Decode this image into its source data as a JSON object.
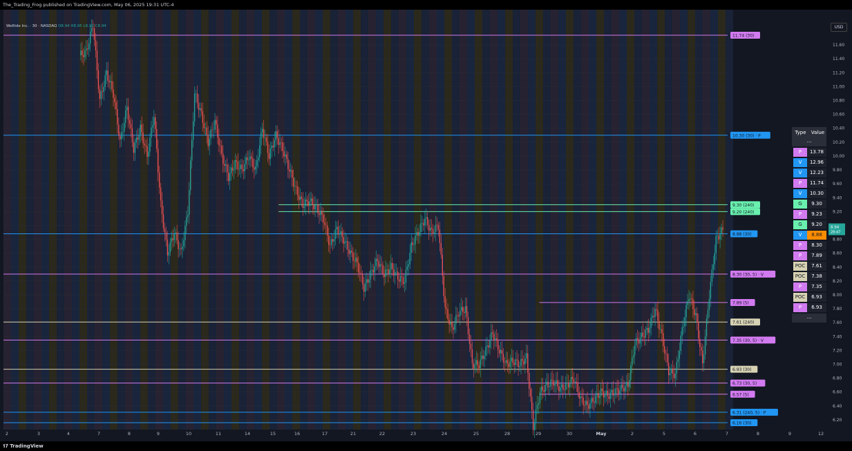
{
  "header": {
    "published": "The_Trading_Frog published on TradingView.com, May 06, 2025 19:31 UTC-4"
  },
  "legend": {
    "symbol": "WeRide Inc. · 30 · NASDAQ",
    "o": "O8.94",
    "h": "H8.95",
    "l": "L8.92",
    "c": "C8.94"
  },
  "currency": "USD",
  "footer": {
    "brand": "TradingView"
  },
  "colors": {
    "bg": "#131722",
    "pivot": "#d27af0",
    "volume": "#2196f3",
    "gap": "#69f0ae",
    "poc": "#d6d2b3",
    "up": "#26a69a",
    "down": "#ef5350",
    "last": "#fb8c00"
  },
  "chart_data": {
    "type": "candlestick",
    "ylim": [
      6.1,
      11.8
    ],
    "y_ticks": [
      "11.60",
      "11.40",
      "11.20",
      "11.00",
      "10.80",
      "10.60",
      "10.40",
      "10.20",
      "10.00",
      "9.80",
      "9.60",
      "9.40",
      "9.20",
      "9.00",
      "8.80",
      "8.60",
      "8.40",
      "8.20",
      "8.00",
      "7.80",
      "7.60",
      "7.40",
      "7.20",
      "7.00",
      "6.80",
      "6.60",
      "6.40",
      "6.20"
    ],
    "x_ticks": [
      "2",
      "3",
      "4",
      "7",
      "8",
      "9",
      "10",
      "11",
      "14",
      "15",
      "16",
      "17",
      "21",
      "22",
      "23",
      "24",
      "25",
      "28",
      "29",
      "30",
      "May",
      "2",
      "5",
      "6",
      "7",
      "8",
      "9",
      "12"
    ],
    "last_price": "8.94",
    "last_price_sub": "8.94",
    "last_price_time": "28:47",
    "price_path": [
      [
        0,
        11.45
      ],
      [
        2,
        11.5
      ],
      [
        3,
        11.9
      ],
      [
        4,
        10.8
      ],
      [
        5,
        11.2
      ],
      [
        6,
        10.9
      ],
      [
        7,
        10.2
      ],
      [
        8,
        10.7
      ],
      [
        9,
        10.1
      ],
      [
        10,
        10.4
      ],
      [
        11,
        10.0
      ],
      [
        12,
        10.6
      ],
      [
        13,
        9.3
      ],
      [
        14,
        8.6
      ],
      [
        15,
        8.9
      ],
      [
        16,
        8.6
      ],
      [
        17,
        9.2
      ],
      [
        18,
        10.9
      ],
      [
        19,
        10.6
      ],
      [
        20,
        10.2
      ],
      [
        21,
        10.5
      ],
      [
        22,
        10.0
      ],
      [
        23,
        9.7
      ],
      [
        24,
        9.9
      ],
      [
        25,
        9.8
      ],
      [
        26,
        10.0
      ],
      [
        27,
        9.8
      ],
      [
        28,
        10.4
      ],
      [
        29,
        10.0
      ],
      [
        30,
        10.3
      ],
      [
        31,
        10.1
      ],
      [
        32,
        9.8
      ],
      [
        33,
        9.5
      ],
      [
        34,
        9.3
      ],
      [
        35,
        9.35
      ],
      [
        36,
        9.25
      ],
      [
        37,
        9.1
      ],
      [
        38,
        8.7
      ],
      [
        39,
        8.95
      ],
      [
        40,
        8.8
      ],
      [
        41,
        8.6
      ],
      [
        42,
        8.45
      ],
      [
        43,
        8.1
      ],
      [
        44,
        8.3
      ],
      [
        45,
        8.5
      ],
      [
        46,
        8.3
      ],
      [
        47,
        8.4
      ],
      [
        48,
        8.25
      ],
      [
        49,
        8.2
      ],
      [
        50,
        8.7
      ],
      [
        51,
        8.9
      ],
      [
        52,
        9.1
      ],
      [
        53,
        8.9
      ],
      [
        54,
        9.0
      ],
      [
        55,
        7.8
      ],
      [
        56,
        7.5
      ],
      [
        57,
        7.75
      ],
      [
        58,
        7.8
      ],
      [
        59,
        7.0
      ],
      [
        60,
        7.0
      ],
      [
        61,
        7.2
      ],
      [
        62,
        7.45
      ],
      [
        63,
        7.2
      ],
      [
        64,
        7.0
      ],
      [
        65,
        7.05
      ],
      [
        66,
        7.0
      ],
      [
        67,
        7.1
      ],
      [
        68,
        6.1
      ],
      [
        69,
        6.6
      ],
      [
        70,
        6.7
      ],
      [
        71,
        6.75
      ],
      [
        72,
        6.65
      ],
      [
        73,
        6.7
      ],
      [
        74,
        6.8
      ],
      [
        75,
        6.5
      ],
      [
        76,
        6.4
      ],
      [
        77,
        6.5
      ],
      [
        78,
        6.6
      ],
      [
        79,
        6.55
      ],
      [
        80,
        6.6
      ],
      [
        81,
        6.65
      ],
      [
        82,
        6.7
      ],
      [
        83,
        7.3
      ],
      [
        84,
        7.4
      ],
      [
        85,
        7.5
      ],
      [
        86,
        7.8
      ],
      [
        87,
        7.4
      ],
      [
        88,
        6.9
      ],
      [
        89,
        6.85
      ],
      [
        90,
        7.5
      ],
      [
        91,
        8.0
      ],
      [
        92,
        7.7
      ],
      [
        93,
        7.0
      ],
      [
        94,
        8.0
      ],
      [
        95,
        8.8
      ],
      [
        96,
        8.94
      ]
    ],
    "levels": [
      {
        "label": "11.74 (30)",
        "price": 11.74,
        "kind": "pivot",
        "start": 0
      },
      {
        "label": "10.30 (30) · P",
        "price": 10.3,
        "kind": "volume",
        "start": 0
      },
      {
        "label": "9.30 (240)",
        "price": 9.3,
        "kind": "gap",
        "start": 0.38
      },
      {
        "label": "9.20 (240)",
        "price": 9.2,
        "kind": "gap",
        "start": 0.38
      },
      {
        "label": "8.88 (30)",
        "price": 8.88,
        "kind": "volume",
        "start": 0
      },
      {
        "label": "8.30 (30, 5) · V",
        "price": 8.3,
        "kind": "pivot",
        "start": 0
      },
      {
        "label": "7.89 (5)",
        "price": 7.89,
        "kind": "pivot",
        "start": 0.74
      },
      {
        "label": "7.61 (240)",
        "price": 7.61,
        "kind": "poc",
        "start": 0
      },
      {
        "label": "7.35 (30, 5) · V",
        "price": 7.35,
        "kind": "pivot",
        "start": 0
      },
      {
        "label": "6.93 (30)",
        "price": 6.93,
        "kind": "poc",
        "start": 0
      },
      {
        "label": "6.73 (30, 5)",
        "price": 6.73,
        "kind": "pivot",
        "start": 0
      },
      {
        "label": "6.57 (5)",
        "price": 6.57,
        "kind": "pivot",
        "start": 0.74
      },
      {
        "label": "6.31 (240, 5) · P",
        "price": 6.31,
        "kind": "volume",
        "start": 0
      },
      {
        "label": "6.16 (30)",
        "price": 6.16,
        "kind": "volume",
        "start": 0
      }
    ]
  },
  "levels_table": {
    "headers": [
      "Type",
      "Value"
    ],
    "top_ellipsis": "...",
    "bottom_ellipsis": "...",
    "rows": [
      {
        "type": "P",
        "value": "13.78",
        "kind": "pivot"
      },
      {
        "type": "V",
        "value": "12.96",
        "kind": "volume"
      },
      {
        "type": "V",
        "value": "12.23",
        "kind": "volume"
      },
      {
        "type": "P",
        "value": "11.74",
        "kind": "pivot"
      },
      {
        "type": "V",
        "value": "10.30",
        "kind": "volume"
      },
      {
        "type": "G",
        "value": "9.30",
        "kind": "gap"
      },
      {
        "type": "P",
        "value": "9.23",
        "kind": "pivot"
      },
      {
        "type": "G",
        "value": "9.20",
        "kind": "gap"
      },
      {
        "type": "V",
        "value": "8.88",
        "kind": "volume",
        "highlight": true
      },
      {
        "type": "P",
        "value": "8.30",
        "kind": "pivot"
      },
      {
        "type": "P",
        "value": "7.89",
        "kind": "pivot"
      },
      {
        "type": "POC",
        "value": "7.61",
        "kind": "poc"
      },
      {
        "type": "POC",
        "value": "7.38",
        "kind": "poc"
      },
      {
        "type": "P",
        "value": "7.35",
        "kind": "pivot"
      },
      {
        "type": "POC",
        "value": "6.93",
        "kind": "poc"
      },
      {
        "type": "P",
        "value": "6.93",
        "kind": "pivot"
      }
    ]
  }
}
